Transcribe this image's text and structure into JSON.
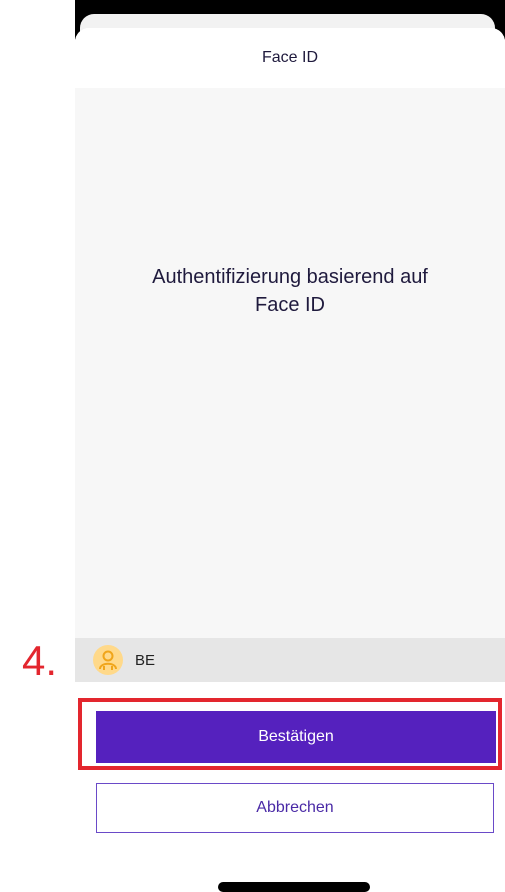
{
  "sheet": {
    "title": "Face ID",
    "message": "Authentifizierung basierend auf\nFace ID"
  },
  "account": {
    "label": "BE",
    "avatar_icon": "user-icon",
    "avatar_color": "#ffd98a"
  },
  "annotation": {
    "step": "4.",
    "color": "#e3262e"
  },
  "actions": {
    "confirm_label": "Bestätigen",
    "cancel_label": "Abbrechen",
    "accent": "#5521be"
  }
}
